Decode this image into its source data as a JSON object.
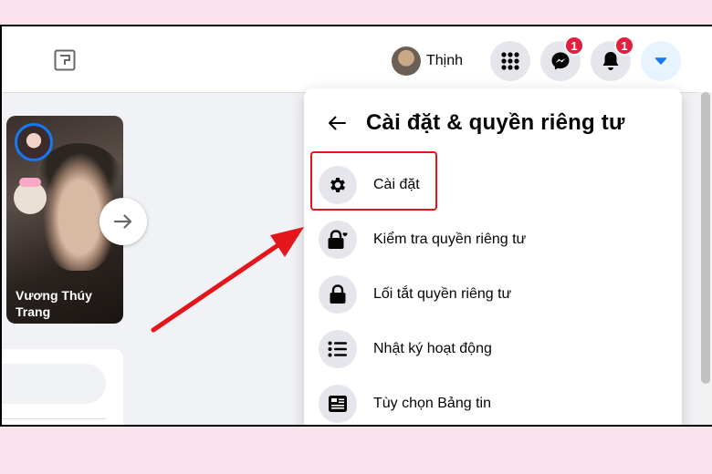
{
  "header": {
    "profile_name": "Thịnh",
    "messenger_badge": "1",
    "notifications_badge": "1"
  },
  "story": {
    "name": "Vương Thúy Trang"
  },
  "menu": {
    "title": "Cài đặt & quyền riêng tư",
    "items": [
      {
        "label": "Cài đặt",
        "icon": "gear-icon"
      },
      {
        "label": "Kiểm tra quyền riêng tư",
        "icon": "lock-heart-icon"
      },
      {
        "label": "Lối tắt quyền riêng tư",
        "icon": "lock-icon"
      },
      {
        "label": "Nhật ký hoạt động",
        "icon": "list-icon"
      },
      {
        "label": "Tùy chọn Bảng tin",
        "icon": "news-feed-icon"
      }
    ]
  },
  "colors": {
    "accent": "#1877f2",
    "badge": "#e41e3f",
    "annotation": "#e4161c",
    "page_background": "#fbe1ec"
  }
}
